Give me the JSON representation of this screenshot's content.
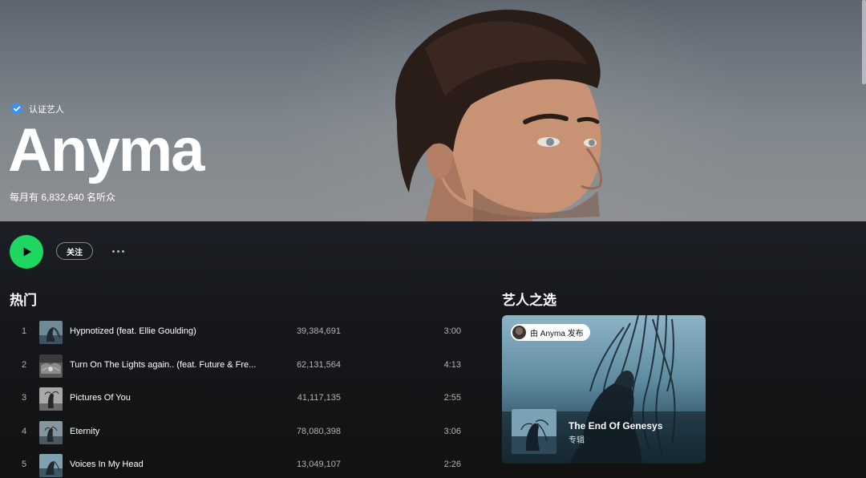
{
  "artist": {
    "verified_label": "认证艺人",
    "name": "Anyma",
    "monthly_listeners": "每月有 6,832,640 名听众"
  },
  "actions": {
    "follow_label": "关注"
  },
  "popular": {
    "title": "热门",
    "tracks": [
      {
        "number": "1",
        "title": "Hypnotized (feat. Ellie Goulding)",
        "plays": "39,384,691",
        "duration": "3:00"
      },
      {
        "number": "2",
        "title": "Turn On The Lights again.. (feat. Future & Fre...",
        "plays": "62,131,564",
        "duration": "4:13"
      },
      {
        "number": "3",
        "title": "Pictures Of You",
        "plays": "41,117,135",
        "duration": "2:55"
      },
      {
        "number": "4",
        "title": "Eternity",
        "plays": "78,080,398",
        "duration": "3:06"
      },
      {
        "number": "5",
        "title": "Voices In My Head",
        "plays": "13,049,107",
        "duration": "2:26"
      }
    ]
  },
  "artist_pick": {
    "title": "艺人之选",
    "badge": "由 Anyma 发布",
    "album_title": "The End Of Genesys",
    "album_type": "专辑"
  },
  "colors": {
    "accent_green": "#1ed760",
    "background": "#121212",
    "text_secondary": "#b3b3b3"
  },
  "icons": {
    "verified": "verified-badge-icon",
    "play": "play-icon",
    "more": "more-options-icon"
  }
}
